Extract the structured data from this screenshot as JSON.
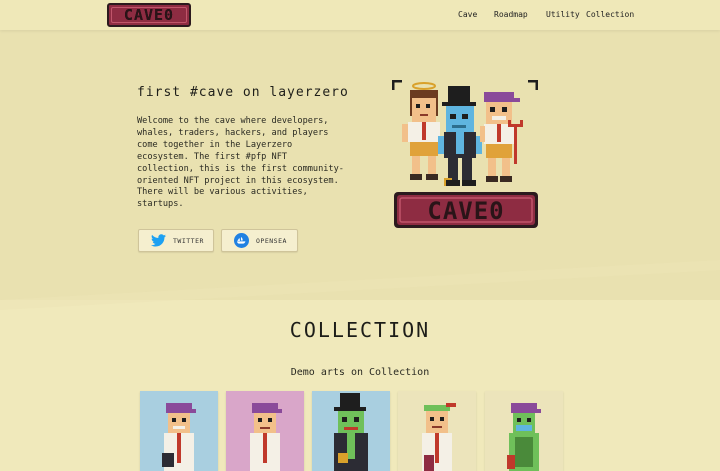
{
  "header": {
    "logo_text": "CAVE0",
    "nav": [
      {
        "label": "Cave"
      },
      {
        "label": "Roadmap"
      },
      {
        "label": "Utility"
      },
      {
        "label": "Collection"
      }
    ]
  },
  "hero": {
    "title": "first #cave on layerzero",
    "description": "Welcome to the cave where developers,\nwhales, traders, hackers, and players\ncome together in the Layerzero\necosystem. The first #pfp NFT\ncollection, this is the first community-\noriented NFT project in this ecosystem.\nThere will be various activities,\nstartups.",
    "buttons": {
      "twitter": "TWITTER",
      "opensea": "OPENSEA"
    },
    "art_logo_text": "CAVE0"
  },
  "collection": {
    "title": "COLLECTION",
    "subtitle": "Demo arts on Collection",
    "cards": [
      {
        "bg": "#a9cfe0"
      },
      {
        "bg": "#d9a6c9"
      },
      {
        "bg": "#a9cfe0"
      },
      {
        "bg": "#ece4bb"
      },
      {
        "bg": "#ece4bb"
      }
    ]
  },
  "colors": {
    "background": "#f0e9bb",
    "hero_bg": "#e9e1b0",
    "logo_red": "#8e2c42",
    "twitter_blue": "#1da1f2",
    "opensea_blue": "#2081e2"
  }
}
